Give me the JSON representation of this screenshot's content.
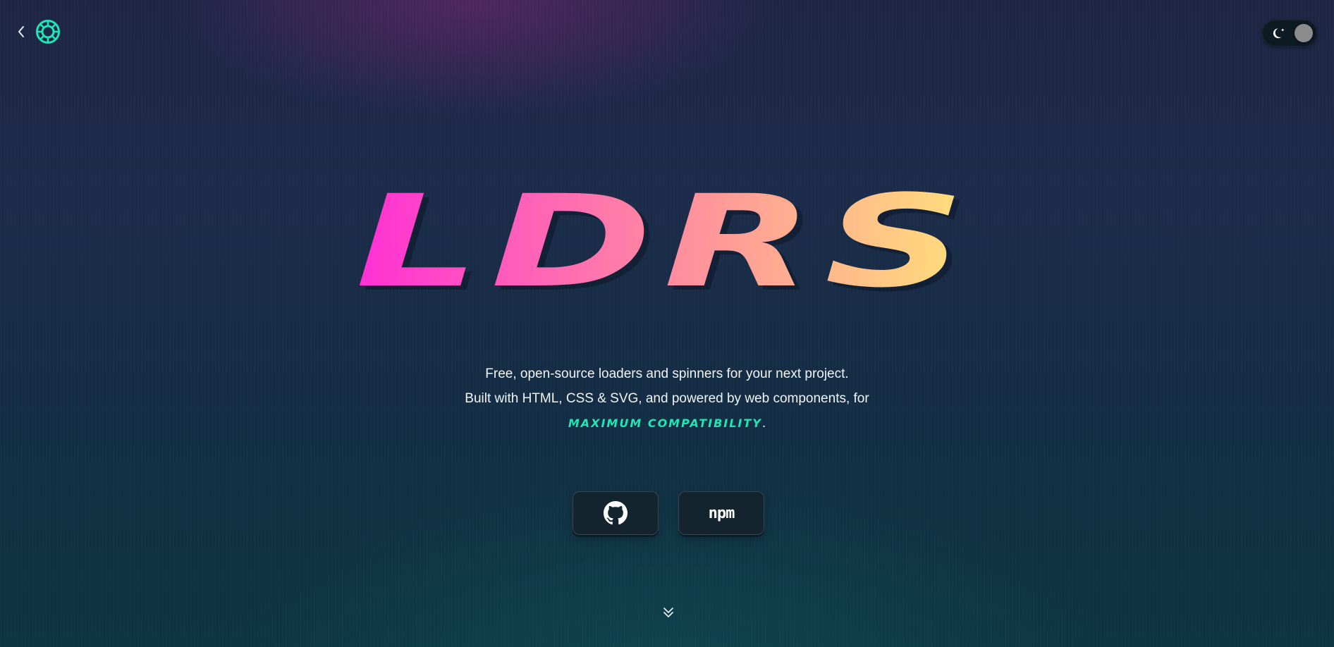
{
  "header": {
    "back_icon": "chevron-left-icon",
    "logo_icon": "spinner-wheel-icon"
  },
  "theme_toggle": {
    "icon": "moon-icon",
    "state": "dark"
  },
  "hero": {
    "title": "LDRS",
    "gradient": [
      "#ff2fd6",
      "#ff8aa0",
      "#ffe27a"
    ]
  },
  "tagline": {
    "line1": "Free, open-source loaders and spinners for your next project.",
    "line2": "Built with HTML, CSS & SVG, and powered by web components, for",
    "highlight": "maximum compatibility",
    "period": "."
  },
  "links": {
    "github_icon": "github-icon",
    "npm_label": "npm"
  },
  "scroll_icon": "double-chevron-down-icon",
  "colors": {
    "accent": "#1fe6b8",
    "button_bg": "#14242f"
  }
}
